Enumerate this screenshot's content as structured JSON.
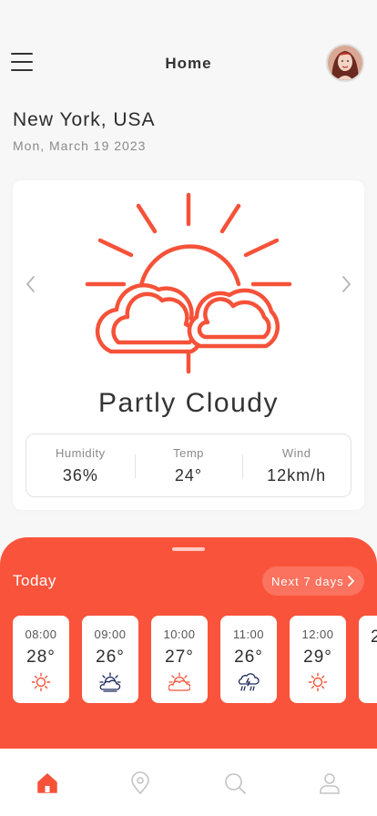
{
  "header": {
    "title": "Home",
    "menu_icon": "hamburger-menu-icon",
    "avatar": "user-avatar"
  },
  "location": {
    "city": "New York, USA",
    "date": "Mon, March 19 2023"
  },
  "current": {
    "condition": "Partly Cloudy",
    "icon": "partly-cloudy-icon",
    "stats": [
      {
        "label": "Humidity",
        "value": "36%"
      },
      {
        "label": "Temp",
        "value": "24°"
      },
      {
        "label": "Wind",
        "value": "12km/h"
      }
    ]
  },
  "forecast": {
    "title": "Today",
    "next_label": "Next 7 days",
    "hours": [
      {
        "time": "08:00",
        "temp": "28°",
        "icon": "sun-icon"
      },
      {
        "time": "09:00",
        "temp": "26°",
        "icon": "sun-cloud-dark-icon"
      },
      {
        "time": "10:00",
        "temp": "27°",
        "icon": "sun-cloud-icon"
      },
      {
        "time": "11:00",
        "temp": "26°",
        "icon": "rain-cloud-icon"
      },
      {
        "time": "12:00",
        "temp": "29°",
        "icon": "sun-icon"
      },
      {
        "time": "",
        "temp": "2",
        "icon": ""
      }
    ]
  },
  "tabs": [
    "home",
    "location",
    "search",
    "profile"
  ],
  "colors": {
    "accent": "#fa533b",
    "background": "#f7f7f7",
    "card": "#ffffff",
    "icon_dark": "#1c2a5a"
  }
}
